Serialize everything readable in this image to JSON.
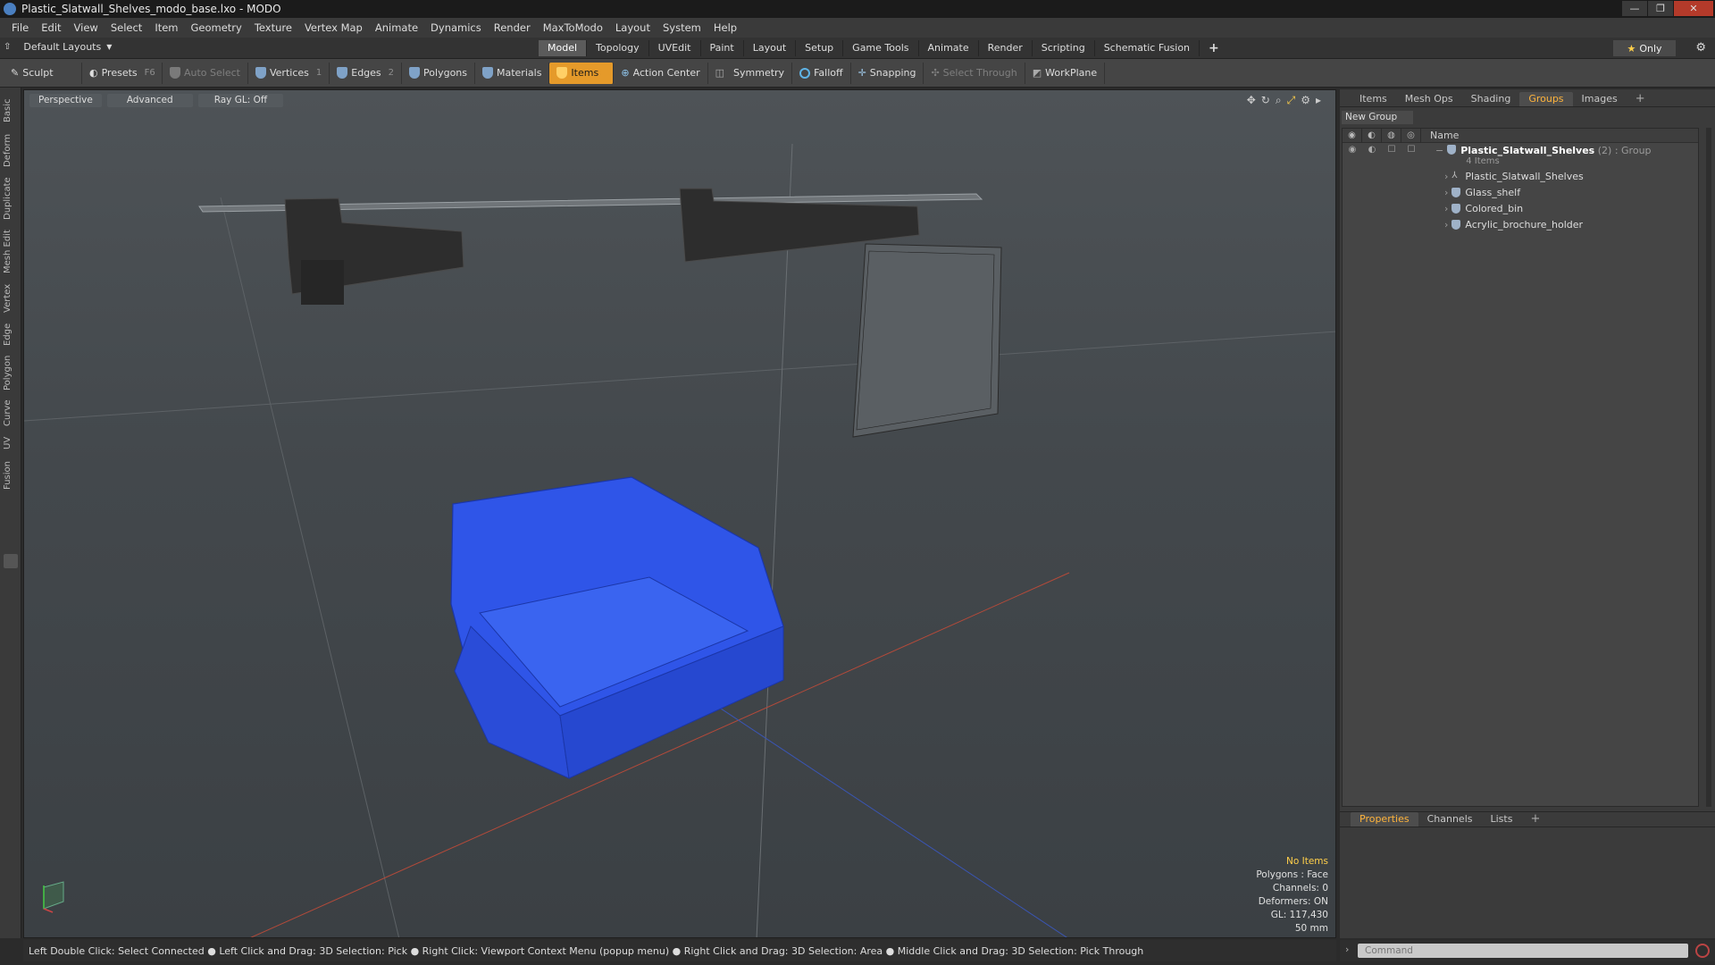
{
  "window": {
    "title": "Plastic_Slatwall_Shelves_modo_base.lxo - MODO",
    "minimize": "—",
    "maximize": "❐",
    "close": "✕"
  },
  "menu": [
    "File",
    "Edit",
    "View",
    "Select",
    "Item",
    "Geometry",
    "Texture",
    "Vertex Map",
    "Animate",
    "Dynamics",
    "Render",
    "MaxToModo",
    "Layout",
    "System",
    "Help"
  ],
  "layoutbar": {
    "layout_label": "Default Layouts",
    "tabs": [
      "Model",
      "Topology",
      "UVEdit",
      "Paint",
      "Layout",
      "Setup",
      "Game Tools",
      "Animate",
      "Render",
      "Scripting",
      "Schematic Fusion"
    ],
    "active_tab": "Model",
    "plus": "+",
    "only_label": "Only"
  },
  "toolbar": {
    "sculpt": "Sculpt",
    "presets": "Presets",
    "presets_key": "F6",
    "auto_select": "Auto Select",
    "vertices": "Vertices",
    "vertices_count": "1",
    "edges": "Edges",
    "edges_count": "2",
    "polygons": "Polygons",
    "materials": "Materials",
    "items": "Items",
    "action_center": "Action Center",
    "symmetry": "Symmetry",
    "falloff": "Falloff",
    "snapping": "Snapping",
    "select_through": "Select Through",
    "workplane": "WorkPlane"
  },
  "left_tabs": [
    "Basic",
    "Deform",
    "Duplicate",
    "Mesh Edit",
    "Vertex",
    "Edge",
    "Polygon",
    "Curve",
    "UV",
    "Fusion"
  ],
  "viewport": {
    "perspective": "Perspective",
    "advanced": "Advanced",
    "raygl": "Ray GL: Off",
    "info": {
      "items": "No Items",
      "polygons": "Polygons : Face",
      "channels": "Channels: 0",
      "deformers": "Deformers: ON",
      "gl": "GL: 117,430",
      "scale": "50 mm"
    }
  },
  "statusbar": "Left Double Click: Select Connected ● Left Click and Drag: 3D Selection: Pick ● Right Click: Viewport Context Menu (popup menu) ● Right Click and Drag: 3D Selection: Area ● Middle Click and Drag: 3D Selection: Pick Through",
  "right_panel": {
    "tabs": [
      "Items",
      "Mesh Ops",
      "Shading",
      "Groups",
      "Images"
    ],
    "active_tab": "Groups",
    "plus": "+",
    "new_group": "New Group",
    "name_header": "Name",
    "group": {
      "name": "Plastic_Slatwall_Shelves",
      "count": "(2)",
      "type": ": Group",
      "sub": "4 Items"
    },
    "children": [
      "Plastic_Slatwall_Shelves",
      "Glass_shelf",
      "Colored_bin",
      "Acrylic_brochure_holder"
    ],
    "prop_tabs": [
      "Properties",
      "Channels",
      "Lists"
    ],
    "prop_active": "Properties",
    "command_placeholder": "Command"
  },
  "colors": {
    "accent": "#e59a2a",
    "bin": "#2f55e8",
    "orange_text": "#ffb43c"
  }
}
